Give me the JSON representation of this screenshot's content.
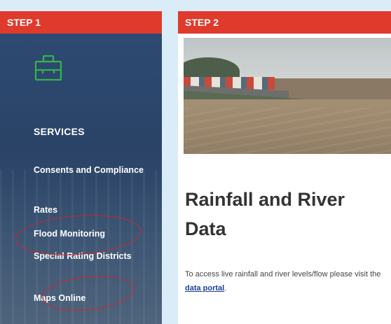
{
  "steps": [
    {
      "label": "STEP 1"
    },
    {
      "label": "STEP 2"
    }
  ],
  "menu": {
    "icon": "briefcase-icon",
    "title": "SERVICES",
    "items": [
      {
        "label": "Consents and Compliance"
      },
      {
        "label": "Rates"
      },
      {
        "label": "Flood Monitoring"
      },
      {
        "label": "Special Rating Districts"
      },
      {
        "label": "Maps Online"
      }
    ]
  },
  "content": {
    "heading": "Rainfall and River Data",
    "paragraph_prefix": "To access live rainfall and river levels/flow please visit the ",
    "link_text": "data portal",
    "paragraph_suffix": "."
  },
  "colors": {
    "step_header": "#e03a2c",
    "icon_green": "#35b34a",
    "highlight_ring": "#d6242a",
    "link": "#1c3f9a"
  }
}
